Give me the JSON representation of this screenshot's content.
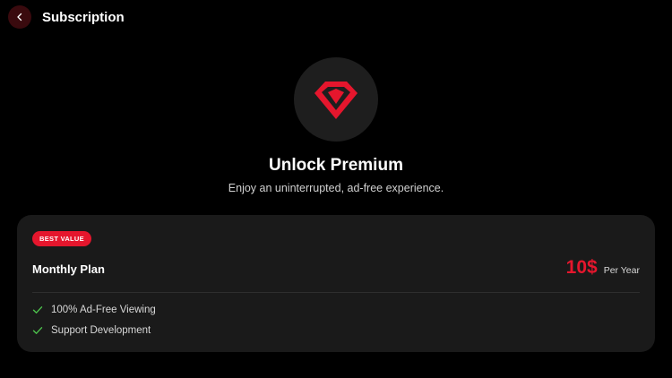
{
  "header": {
    "title": "Subscription",
    "back_icon": "chevron-left-icon"
  },
  "hero": {
    "icon": "diamond-icon",
    "title": "Unlock Premium",
    "subtitle": "Enjoy an uninterrupted, ad-free experience."
  },
  "plan": {
    "badge": "BEST VALUE",
    "name": "Monthly Plan",
    "price": "10$",
    "period": "Per Year",
    "features": [
      {
        "icon": "check-icon",
        "label": "100% Ad-Free Viewing"
      },
      {
        "icon": "check-icon",
        "label": "Support Development"
      }
    ]
  },
  "colors": {
    "accent": "#e5162d",
    "background": "#000000",
    "card": "#1a1a1a",
    "check": "#4cc14c"
  }
}
